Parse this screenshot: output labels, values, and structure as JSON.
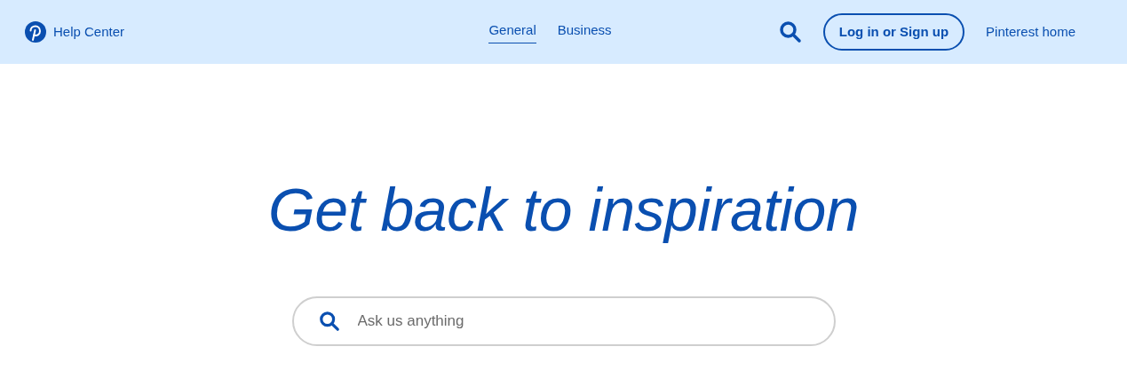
{
  "header": {
    "brand": "Help Center",
    "tabs": [
      {
        "label": "General",
        "selected": true
      },
      {
        "label": "Business",
        "selected": false
      }
    ],
    "login_button": "Log in or Sign up",
    "home_link": "Pinterest home"
  },
  "hero": {
    "title": "Get back to inspiration",
    "search": {
      "placeholder": "Ask us anything"
    }
  }
}
